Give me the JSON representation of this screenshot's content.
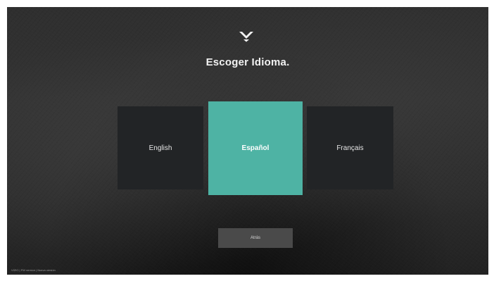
{
  "screen": {
    "title": "Escoger Idioma.",
    "logo_icon": "vizio-chevron-logo-icon"
  },
  "languages": [
    {
      "label": "English",
      "selected": false
    },
    {
      "label": "Español",
      "selected": true
    },
    {
      "label": "Français",
      "selected": false
    }
  ],
  "back_button": {
    "label": "Atrás"
  },
  "footer": {
    "text": "VIZIO | FW version | Nueva versión"
  },
  "colors": {
    "selected_tile": "#4eb3a4",
    "unselected_tile": "#222426",
    "background": "#2f2f2f",
    "back_button": "#4a4a4a"
  }
}
